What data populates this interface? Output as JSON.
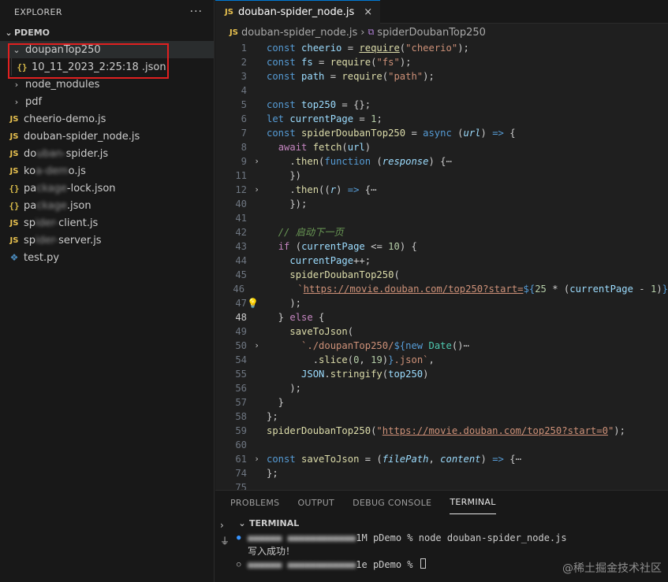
{
  "sidebar": {
    "title": "EXPLORER",
    "more_icon": "···",
    "root_label": "PDEMO",
    "items": [
      {
        "label": "doupanTop250",
        "kind": "folder-open",
        "icon": "chevron-down-icon"
      },
      {
        "label": "10_11_2023_2:25:18 .json",
        "kind": "json",
        "icon": "{}"
      },
      {
        "label": "node_modules",
        "kind": "folder",
        "icon": "chevron-right-icon"
      },
      {
        "label": "pdf",
        "kind": "folder",
        "icon": "chevron-right-icon"
      },
      {
        "label": "cheerio-demo.js",
        "kind": "js",
        "icon": "JS"
      },
      {
        "label": "douban-spider_node.js",
        "kind": "js",
        "icon": "JS"
      },
      {
        "label": "douban-spider.js",
        "kind": "js",
        "icon": "JS",
        "blurred": true
      },
      {
        "label": "koa-demo.js",
        "kind": "js",
        "icon": "JS",
        "blurred": true
      },
      {
        "label": "package-lock.json",
        "kind": "json",
        "icon": "{}",
        "blurred": true
      },
      {
        "label": "package.json",
        "kind": "json",
        "icon": "{}",
        "blurred": true
      },
      {
        "label": "spider-client.js",
        "kind": "js",
        "icon": "JS",
        "blurred": true
      },
      {
        "label": "spider-server.js",
        "kind": "js",
        "icon": "JS",
        "blurred": true
      },
      {
        "label": "test.py",
        "kind": "py",
        "icon": "python-icon"
      }
    ]
  },
  "editor": {
    "tab_label": "douban-spider_node.js",
    "tab_icon": "JS",
    "close_icon": "×",
    "breadcrumb_file": "douban-spider_node.js",
    "breadcrumb_symbol": "spiderDoubanTop250",
    "active_line": "48"
  },
  "code_lines": [
    {
      "n": "1",
      "html": "<span class='k'>const</span> <span class='v'>cheerio</span> = <span class='fn u'>require</span>(<span class='s'>\"cheerio\"</span>);"
    },
    {
      "n": "2",
      "html": "<span class='k'>const</span> <span class='v'>fs</span> = <span class='fn'>require</span>(<span class='s'>\"fs\"</span>);"
    },
    {
      "n": "3",
      "html": "<span class='k'>const</span> <span class='v'>path</span> = <span class='fn'>require</span>(<span class='s'>\"path\"</span>);"
    },
    {
      "n": "4",
      "html": ""
    },
    {
      "n": "5",
      "html": "<span class='k'>const</span> <span class='v'>top250</span> = {};"
    },
    {
      "n": "6",
      "html": "<span class='k'>let</span> <span class='v'>currentPage</span> = <span class='n'>1</span>;"
    },
    {
      "n": "7",
      "html": "<span class='k'>const</span> <span class='fn'>spiderDoubanTop250</span> = <span class='k'>async</span> (<span class='p'>url</span>) <span class='k'>=&gt;</span> {"
    },
    {
      "n": "8",
      "html": "  <span class='kc'>await</span> <span class='fn'>fetch</span>(<span class='v'>url</span>)"
    },
    {
      "n": "9",
      "fold": true,
      "html": "    .<span class='fn'>then</span>(<span class='k'>function</span> (<span class='p'>response</span>) {<span class='ct'>⋯</span>"
    },
    {
      "n": "11",
      "html": "    })"
    },
    {
      "n": "12",
      "fold": true,
      "html": "    .<span class='fn'>then</span>((<span class='p'>r</span>) <span class='k'>=&gt;</span> {<span class='ct'>⋯</span>"
    },
    {
      "n": "40",
      "html": "    });"
    },
    {
      "n": "41",
      "html": ""
    },
    {
      "n": "42",
      "html": "  <span class='c'>// 启动下一页</span>"
    },
    {
      "n": "43",
      "html": "  <span class='kc'>if</span> (<span class='v'>currentPage</span> &lt;= <span class='n'>10</span>) {"
    },
    {
      "n": "44",
      "html": "    <span class='v'>currentPage</span>++;"
    },
    {
      "n": "45",
      "html": "    <span class='fn'>spiderDoubanTop250</span>("
    },
    {
      "n": "46",
      "html": "      <span class='s'>`<span class='u'>https://movie.douban.com/top250?start=</span></span><span class='k'>${</span><span class='n'>25</span> * (<span class='v'>currentPage</span> - <span class='n'>1</span>)<span class='k'>}</span>"
    },
    {
      "n": "47",
      "bulb": true,
      "html": "    );"
    },
    {
      "n": "48",
      "html": "  } <span class='kc'>else</span> {"
    },
    {
      "n": "49",
      "html": "    <span class='fn'>saveToJson</span>("
    },
    {
      "n": "50",
      "fold": true,
      "html": "      <span class='s'>`./doupanTop250/</span><span class='k'>${</span><span class='k'>new</span> <span class='cl'>Date</span>()<span class='ct'>⋯</span>"
    },
    {
      "n": "54",
      "html": "        .<span class='fn'>slice</span>(<span class='n'>0</span>, <span class='n'>19</span>)<span class='k'>}</span><span class='s'>.json`</span>,"
    },
    {
      "n": "55",
      "html": "      <span class='v'>JSON</span>.<span class='fn'>stringify</span>(<span class='v'>top250</span>)"
    },
    {
      "n": "56",
      "html": "    );"
    },
    {
      "n": "57",
      "html": "  }"
    },
    {
      "n": "58",
      "html": "};"
    },
    {
      "n": "59",
      "html": "<span class='fn'>spiderDoubanTop250</span>(<span class='s'>\"<span class='u'>https://movie.douban.com/top250?start=0</span>\"</span>);"
    },
    {
      "n": "60",
      "html": ""
    },
    {
      "n": "61",
      "fold": true,
      "html": "<span class='k'>const</span> <span class='fn'>saveToJson</span> = (<span class='p'>filePath</span>, <span class='p'>content</span>) <span class='k'>=&gt;</span> {<span class='ct'>⋯</span>"
    },
    {
      "n": "74",
      "html": "};"
    },
    {
      "n": "75",
      "html": ""
    }
  ],
  "panel": {
    "tabs": [
      "PROBLEMS",
      "OUTPUT",
      "DEBUG CONSOLE",
      "TERMINAL"
    ],
    "active_tab": "TERMINAL",
    "terminal_title": "TERMINAL",
    "lines": [
      {
        "prefix": "1M",
        "text": " pDemo % node douban-spider_node.js"
      },
      {
        "text": "写入成功！"
      },
      {
        "prefix": "1e",
        "text": " pDemo % "
      }
    ]
  },
  "watermark": "@稀土掘金技术社区"
}
